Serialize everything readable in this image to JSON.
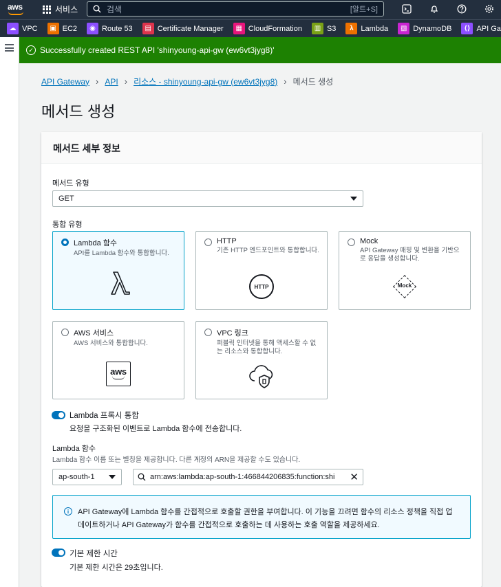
{
  "topbar": {
    "services_label": "서비스",
    "search_placeholder": "검색",
    "search_shortcut": "[알트+S]",
    "icons": [
      "cloudshell-icon",
      "bell-icon",
      "help-icon",
      "gear-icon"
    ]
  },
  "favorites": [
    {
      "label": "VPC",
      "color": "#8c4fff"
    },
    {
      "label": "EC2",
      "color": "#ed7100"
    },
    {
      "label": "Route 53",
      "color": "#8c4fff"
    },
    {
      "label": "Certificate Manager",
      "color": "#dd344c"
    },
    {
      "label": "CloudFormation",
      "color": "#e7157b"
    },
    {
      "label": "S3",
      "color": "#7aa116"
    },
    {
      "label": "Lambda",
      "color": "#ed7100"
    },
    {
      "label": "DynamoDB",
      "color": "#c925d1"
    },
    {
      "label": "API Gateway",
      "color": "#8c4fff"
    }
  ],
  "flash": {
    "message": "Successfully created REST API 'shinyoung-api-gw (ew6vt3jyg8)'"
  },
  "breadcrumb": {
    "items": [
      "API Gateway",
      "API",
      "리소스 - shinyoung-api-gw (ew6vt3jyg8)",
      "메서드 생성"
    ]
  },
  "page": {
    "title": "메서드 생성"
  },
  "panel": {
    "header": "메서드 세부 정보",
    "method_type_label": "메서드 유형",
    "method_type_value": "GET",
    "integration_label": "통합 유형",
    "tiles": [
      {
        "title": "Lambda 함수",
        "desc": "API를 Lambda 함수와 통합합니다.",
        "selected": true
      },
      {
        "title": "HTTP",
        "desc": "기존 HTTP 엔드포인트와 통합합니다.",
        "selected": false
      },
      {
        "title": "Mock",
        "desc": "API Gateway 매핑 및 변환을 기반으로 응답을 생성합니다.",
        "selected": false
      },
      {
        "title": "AWS 서비스",
        "desc": "AWS 서비스와 통합합니다.",
        "selected": false
      },
      {
        "title": "VPC 링크",
        "desc": "퍼블릭 인터넷을 통해 액세스할 수 없는 리소스와 통합합니다.",
        "selected": false
      }
    ],
    "http_icon_text": "HTTP",
    "mock_icon_text": "Mock",
    "aws_icon_text": "aws",
    "proxy_toggle_label": "Lambda 프록시 통합",
    "proxy_toggle_desc": "요청을 구조화된 이벤트로 Lambda 함수에 전송합니다.",
    "lambda_fn_label": "Lambda 함수",
    "lambda_fn_desc": "Lambda 함수 이름 또는 별칭을 제공합니다. 다른 계정의 ARN을 제공할 수도 있습니다.",
    "region_value": "ap-south-1",
    "arn_value": "arn:aws:lambda:ap-south-1:466844206835:function:shi",
    "info_text": "API Gateway에 Lambda 함수를 간접적으로 호출할 권한을 부여합니다. 이 기능을 끄려면 함수의 리소스 정책을 직접 업데이트하거나 API Gateway가 함수를 간접적으로 호출하는 데 사용하는 호출 역할을 제공하세요.",
    "timeout_toggle_label": "기본 제한 시간",
    "timeout_toggle_desc": "기본 제한 시간은 29초입니다."
  }
}
